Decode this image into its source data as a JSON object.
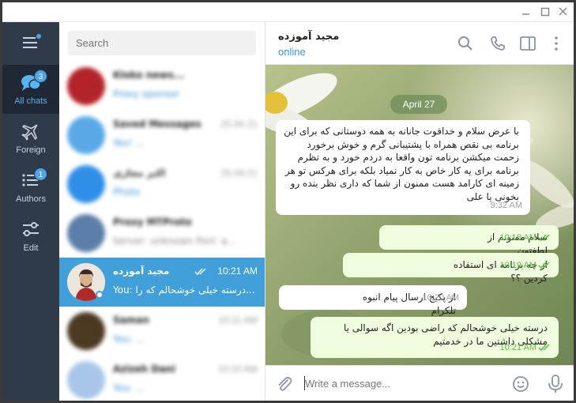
{
  "window": {
    "controls": [
      "minimize",
      "maximize",
      "close"
    ]
  },
  "folders": {
    "items": [
      {
        "label": "All chats",
        "icon": "chats-icon",
        "badge": "3"
      },
      {
        "label": "Foreign",
        "icon": "airplane-icon",
        "badge": ""
      },
      {
        "label": "Authors",
        "icon": "list-icon",
        "badge": "1"
      },
      {
        "label": "Edit",
        "icon": "sliders-icon",
        "badge": ""
      }
    ]
  },
  "search": {
    "placeholder": "Search"
  },
  "chats": [
    {
      "name": "Kloko news...",
      "preview": "Proxy sponsor",
      "time": "",
      "avatar_color": "#b3242a"
    },
    {
      "name": "Saved Messages",
      "preview": "Yes! ...",
      "time": "25.04.21",
      "avatar_color": "#5aa9e6"
    },
    {
      "name": "اکبر مجازی",
      "preview": "Photo",
      "time": "25.04.21",
      "avatar_color": "#2f8fe8"
    },
    {
      "name": "Proxy MTProto",
      "preview": "Server: unknown Port: a...",
      "time": "",
      "avatar_color": "#5b7fa8"
    },
    {
      "name": "مجید آموزده",
      "preview": "You: درسته خیلی خوشحالم که را...",
      "time": "10:21 AM",
      "avatar_color": "#c9b59b"
    },
    {
      "name": "Saman",
      "preview": "You: ...",
      "time": "10:11 AM",
      "avatar_color": "#4b3a22"
    },
    {
      "name": "Azizeh Dani",
      "preview": "You: ...",
      "time": "10:10 AM",
      "avatar_color": "#a8c7e8"
    }
  ],
  "chat": {
    "title": "مجید آموزده",
    "status": "online",
    "date_label": "April 27",
    "messages": [
      {
        "dir": "in",
        "text": "با عرض سلام و خداقوت جانانه به همه دوستانی که برای این برنامه بی نقص همراه با پشتیبانی گرم و خوش برخورد زحمت میکشن برنامه تون واقعا به دردم خورد و به نظرم برنامه برای یه کار خاص به کار نمیاد بلکه برای هرکس تو هر زمینه ای کارامد هست ممنون از شما که داری نظر بنده رو بخونی یا علی",
        "time": "9:32 AM"
      },
      {
        "dir": "out",
        "text": "سلام ممنونم از لطفتون",
        "time": "10:18 AM"
      },
      {
        "dir": "out",
        "text": "از چه برنامه ای استفاده کردین ؟؟",
        "time": "10:19 AM"
      },
      {
        "dir": "in",
        "text": "از پکیج ارسال پیام انبوه تلکرام",
        "time": "10:20 AM"
      },
      {
        "dir": "out",
        "text": "درسته خیلی خوشحالم که راضی بودین اگه سوالی یا مشکلی داشتین ما در خدمتیم",
        "time": "10:21 AM"
      }
    ],
    "composer_placeholder": "Write a message..."
  },
  "colors": {
    "sidebar": "#2f3b49",
    "accent": "#419fd9",
    "outgoing": "#effdde",
    "check": "#5fb84a"
  }
}
